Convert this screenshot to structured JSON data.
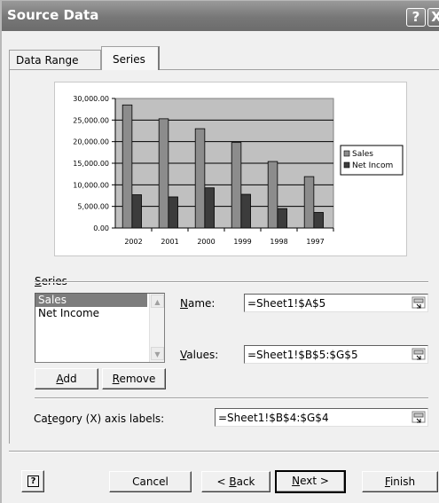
{
  "window": {
    "title": "Source Data",
    "help_glyph": "?",
    "close_glyph": "X"
  },
  "tabs": [
    {
      "label": "Data Range",
      "active": false
    },
    {
      "label": "Series",
      "active": true
    }
  ],
  "chart_data": {
    "type": "bar",
    "categories": [
      "2002",
      "2001",
      "2000",
      "1999",
      "1998",
      "1997"
    ],
    "series": [
      {
        "name": "Sales",
        "values": [
          28500,
          25300,
          23000,
          19800,
          15400,
          11900
        ],
        "color": "#8c8c8c"
      },
      {
        "name": "Net Incom",
        "values": [
          7700,
          7200,
          9300,
          7800,
          4500,
          3600
        ],
        "color": "#3c3c3c"
      }
    ],
    "yticks": [
      "30,000.00",
      "25,000.00",
      "20,000.00",
      "15,000.00",
      "10,000.00",
      "5,000.00",
      "0.00"
    ],
    "ylim": [
      0,
      30000
    ],
    "grid": true,
    "legend": "right",
    "plot_background": "#c0c0c0"
  },
  "series_section": {
    "label_pre": "",
    "label_u": "S",
    "label_post": "eries",
    "items": [
      {
        "label": "Sales",
        "selected": true
      },
      {
        "label": "Net Income",
        "selected": false
      }
    ]
  },
  "name_field": {
    "label_u": "N",
    "label_post": "ame:",
    "value": "=Sheet1!$A$5"
  },
  "values_field": {
    "label_u": "V",
    "label_post": "alues:",
    "value": "=Sheet1!$B$5:$G$5"
  },
  "add_button": {
    "u": "A",
    "post": "dd"
  },
  "remove_button": {
    "u": "R",
    "post": "emove"
  },
  "category_field": {
    "label_pre": "Ca",
    "label_u": "t",
    "label_post": "egory (X) axis labels:",
    "value": "=Sheet1!$B$4:$G$4"
  },
  "footer": {
    "help_glyph": "?",
    "cancel": "Cancel",
    "back_pre": "< ",
    "back_u": "B",
    "back_post": "ack",
    "next_u": "N",
    "next_post": "ext >",
    "finish_u": "F",
    "finish_post": "inish"
  }
}
